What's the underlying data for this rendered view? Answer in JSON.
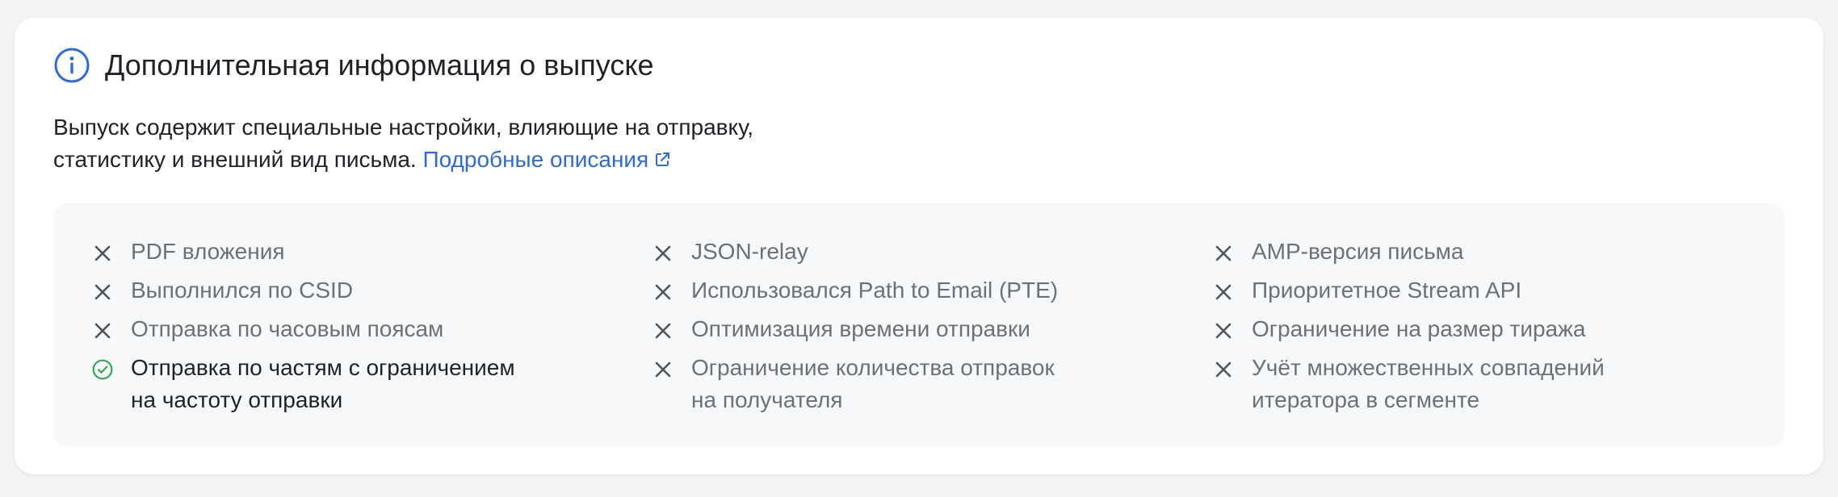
{
  "panel": {
    "title": "Дополнительная информация о выпуске",
    "description_line1": "Выпуск содержит специальные настройки, влияющие на отправку,",
    "description_line2": "статистику и внешний вид письма.",
    "link_label": "Подробные описания",
    "icons": {
      "title": "info-icon",
      "link": "external-link-icon",
      "enabled": "check-circle-icon",
      "disabled": "cross-icon"
    },
    "colors": {
      "accent": "#2f6bd6",
      "enabled": "#34a853",
      "disabled_text": "#6b717a",
      "enabled_text": "#1f2328"
    }
  },
  "features": {
    "columns": [
      [
        {
          "label": "PDF вложения",
          "enabled": false
        },
        {
          "label": "Выполнился по CSID",
          "enabled": false
        },
        {
          "label": "Отправка по часовым поясам",
          "enabled": false
        },
        {
          "label": "Отправка по частям с ограничением\nна частоту отправки",
          "enabled": true
        }
      ],
      [
        {
          "label": "JSON-relay",
          "enabled": false
        },
        {
          "label": "Использовался Path to Email (PTE)",
          "enabled": false
        },
        {
          "label": "Оптимизация времени отправки",
          "enabled": false
        },
        {
          "label": "Ограничение количества отправок\nна получателя",
          "enabled": false
        }
      ],
      [
        {
          "label": "AMP-версия письма",
          "enabled": false
        },
        {
          "label": "Приоритетное Stream API",
          "enabled": false
        },
        {
          "label": "Ограничение на размер тиража",
          "enabled": false
        },
        {
          "label": "Учёт множественных совпадений\nитератора в сегменте",
          "enabled": false
        }
      ]
    ]
  }
}
